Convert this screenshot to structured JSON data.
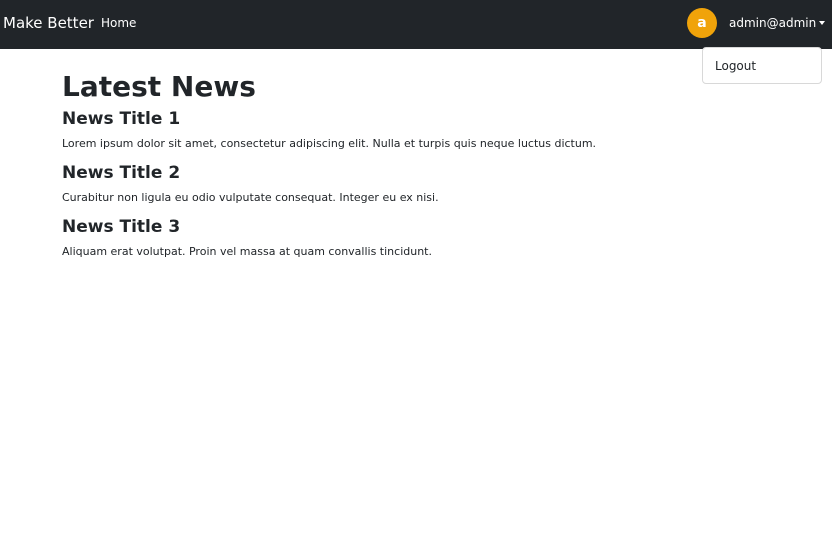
{
  "navbar": {
    "brand": "Make Better",
    "links": [
      {
        "label": "Home"
      }
    ],
    "user": {
      "avatar_letter": "a",
      "avatar_color": "#f0a30a",
      "email": "admin@admin",
      "menu": [
        {
          "label": "Logout"
        }
      ]
    }
  },
  "main": {
    "title": "Latest News",
    "news": [
      {
        "title": "News Title 1",
        "body": "Lorem ipsum dolor sit amet, consectetur adipiscing elit. Nulla et turpis quis neque luctus dictum."
      },
      {
        "title": "News Title 2",
        "body": "Curabitur non ligula eu odio vulputate consequat. Integer eu ex nisi."
      },
      {
        "title": "News Title 3",
        "body": "Aliquam erat volutpat. Proin vel massa at quam convallis tincidunt."
      }
    ]
  }
}
